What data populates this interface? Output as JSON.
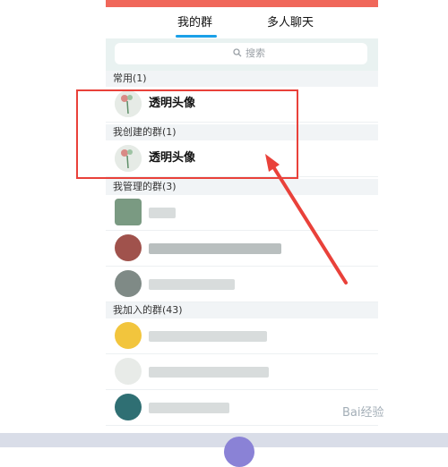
{
  "tabs": [
    {
      "label": "我的群",
      "selected": true
    },
    {
      "label": "多人聊天",
      "selected": false
    }
  ],
  "search": {
    "placeholder": "搜索"
  },
  "sections": {
    "frequent": "常用(1)",
    "created": "我创建的群(1)",
    "managed": "我管理的群(3)",
    "joined": "我加入的群(43)"
  },
  "rows": {
    "frequent_group": "透明头像",
    "created_group": "透明头像"
  },
  "annotation": {
    "highlight_color": "#e9413a",
    "arrow_color": "#e9413a"
  },
  "watermark": "Bai经验",
  "colors": {
    "accent": "#1aa0e8",
    "header": "#f0675a"
  }
}
